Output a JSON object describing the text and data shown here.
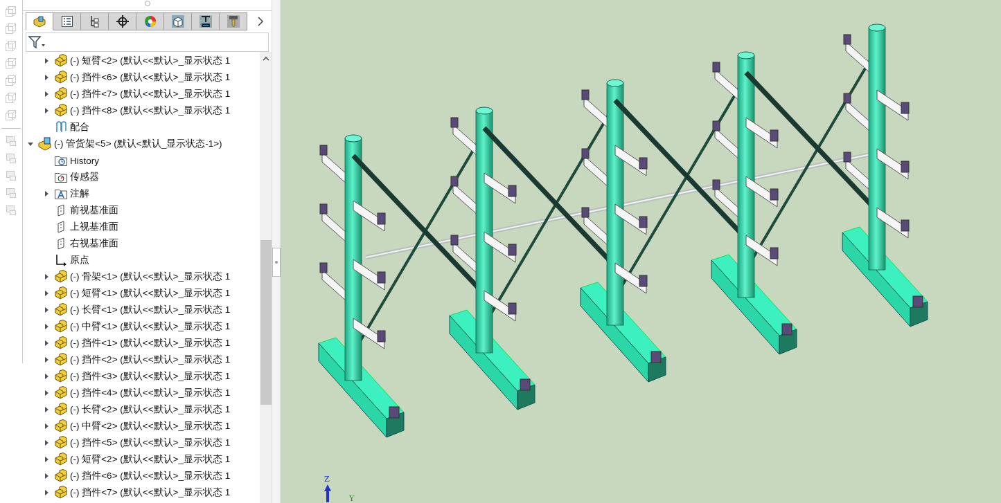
{
  "tabs": [
    {
      "kind": "feature-tree",
      "selected": true
    },
    {
      "kind": "property",
      "selected": false
    },
    {
      "kind": "configuration",
      "selected": false
    },
    {
      "kind": "dimxpert",
      "selected": false
    },
    {
      "kind": "appearance",
      "selected": false
    },
    {
      "kind": "display",
      "selected": false
    },
    {
      "kind": "press",
      "selected": false
    },
    {
      "kind": "tool",
      "selected": false
    }
  ],
  "tree": {
    "continued_children": [
      {
        "kind": "component",
        "label": "(-) 短臂<2> (默认<<默认>_显示状态 1",
        "expanded": false
      },
      {
        "kind": "component",
        "label": "(-) 挡件<6> (默认<<默认>_显示状态 1",
        "expanded": false
      },
      {
        "kind": "component",
        "label": "(-) 挡件<7> (默认<<默认>_显示状态 1",
        "expanded": false
      },
      {
        "kind": "component",
        "label": "(-) 挡件<8> (默认<<默认>_显示状态 1",
        "expanded": false
      },
      {
        "kind": "mates",
        "label": "配合"
      }
    ],
    "items": [
      {
        "kind": "assembly",
        "label": "(-) 管货架<5> (默认<默认_显示状态-1>)",
        "expanded": true,
        "children": [
          {
            "kind": "history",
            "label": "History"
          },
          {
            "kind": "sensors",
            "label": "传感器"
          },
          {
            "kind": "annotations",
            "label": "注解",
            "expanded": false
          },
          {
            "kind": "plane",
            "label": "前视基准面"
          },
          {
            "kind": "plane",
            "label": "上视基准面"
          },
          {
            "kind": "plane",
            "label": "右视基准面"
          },
          {
            "kind": "origin",
            "label": "原点"
          },
          {
            "kind": "component",
            "label": "(-) 骨架<1> (默认<<默认>_显示状态 1",
            "expanded": false
          },
          {
            "kind": "component",
            "label": "(-) 短臂<1> (默认<<默认>_显示状态 1",
            "expanded": false
          },
          {
            "kind": "component",
            "label": "(-) 长臂<1> (默认<<默认>_显示状态 1",
            "expanded": false
          },
          {
            "kind": "component",
            "label": "(-) 中臂<1> (默认<<默认>_显示状态 1",
            "expanded": false
          },
          {
            "kind": "component",
            "label": "(-) 挡件<1> (默认<<默认>_显示状态 1",
            "expanded": false
          },
          {
            "kind": "component",
            "label": "(-) 挡件<2> (默认<<默认>_显示状态 1",
            "expanded": false
          },
          {
            "kind": "component",
            "label": "(-) 挡件<3> (默认<<默认>_显示状态 1",
            "expanded": false
          },
          {
            "kind": "component",
            "label": "(-) 挡件<4> (默认<<默认>_显示状态 1",
            "expanded": false
          },
          {
            "kind": "component",
            "label": "(-) 长臂<2> (默认<<默认>_显示状态 1",
            "expanded": false
          },
          {
            "kind": "component",
            "label": "(-) 中臂<2> (默认<<默认>_显示状态 1",
            "expanded": false
          },
          {
            "kind": "component",
            "label": "(-) 挡件<5> (默认<<默认>_显示状态 1",
            "expanded": false
          },
          {
            "kind": "component",
            "label": "(-) 短臂<2> (默认<<默认>_显示状态 1",
            "expanded": false
          },
          {
            "kind": "component",
            "label": "(-) 挡件<6> (默认<<默认>_显示状态 1",
            "expanded": false
          },
          {
            "kind": "component",
            "label": "(-) 挡件<7> (默认<<默认>_显示状态 1",
            "expanded": false
          }
        ]
      }
    ]
  },
  "triad": {
    "z_label": "Z",
    "y_label": "Y"
  }
}
